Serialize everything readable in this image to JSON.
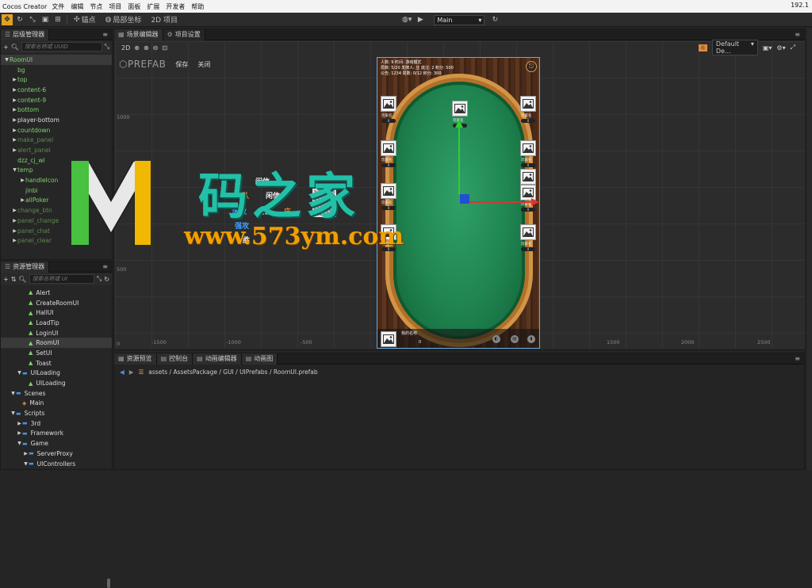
{
  "titlebar": {
    "app": "Cocos Creator",
    "menu": [
      "文件",
      "编辑",
      "节点",
      "项目",
      "面板",
      "扩展",
      "开发者",
      "帮助"
    ],
    "ip": "192.1"
  },
  "toolbar": {
    "pivot": "锚点",
    "local": "局部坐标",
    "mode2d": "2D 项目",
    "platform": "Main"
  },
  "hierarchy": {
    "tab": "层级管理器",
    "search_placeholder": "搜索名称或 UUID",
    "items": [
      {
        "label": "RoomUI",
        "indent": 0,
        "arrow": "▼",
        "color": "green",
        "selected": true
      },
      {
        "label": "bg",
        "indent": 1,
        "arrow": "",
        "color": "green"
      },
      {
        "label": "top",
        "indent": 1,
        "arrow": "▶",
        "color": "green"
      },
      {
        "label": "content-6",
        "indent": 1,
        "arrow": "▶",
        "color": "green"
      },
      {
        "label": "content-9",
        "indent": 1,
        "arrow": "▶",
        "color": "green"
      },
      {
        "label": "bottom",
        "indent": 1,
        "arrow": "▶",
        "color": "green"
      },
      {
        "label": "player-bottom",
        "indent": 1,
        "arrow": "▶",
        "color": "white"
      },
      {
        "label": "countdown",
        "indent": 1,
        "arrow": "▶",
        "color": "green"
      },
      {
        "label": "make_panel",
        "indent": 1,
        "arrow": "▶",
        "color": "dim"
      },
      {
        "label": "alert_panel",
        "indent": 1,
        "arrow": "▶",
        "color": "dim"
      },
      {
        "label": "dzz_cj_wl",
        "indent": 1,
        "arrow": "",
        "color": "green"
      },
      {
        "label": "temp",
        "indent": 1,
        "arrow": "▼",
        "color": "green"
      },
      {
        "label": "handleIcon",
        "indent": 2,
        "arrow": "▶",
        "color": "green"
      },
      {
        "label": "jinbi",
        "indent": 2,
        "arrow": "",
        "color": "green"
      },
      {
        "label": "allPoker",
        "indent": 2,
        "arrow": "▶",
        "color": "green"
      },
      {
        "label": "change_btn",
        "indent": 1,
        "arrow": "▶",
        "color": "dim"
      },
      {
        "label": "panel_change",
        "indent": 1,
        "arrow": "▶",
        "color": "dim"
      },
      {
        "label": "panel_chat",
        "indent": 1,
        "arrow": "▶",
        "color": "dim"
      },
      {
        "label": "panel_clear",
        "indent": 1,
        "arrow": "▶",
        "color": "dim"
      }
    ]
  },
  "assets": {
    "tab": "资源管理器",
    "search_placeholder": "搜索名称或 UI",
    "items": [
      {
        "label": "Alert",
        "indent": 3,
        "arrow": "",
        "icon": "prefab",
        "sel": false
      },
      {
        "label": "CreateRoomUI",
        "indent": 3,
        "arrow": "",
        "icon": "prefab",
        "sel": false
      },
      {
        "label": "HallUI",
        "indent": 3,
        "arrow": "",
        "icon": "prefab",
        "sel": false
      },
      {
        "label": "LoadTip",
        "indent": 3,
        "arrow": "",
        "icon": "prefab",
        "sel": false
      },
      {
        "label": "LoginUI",
        "indent": 3,
        "arrow": "",
        "icon": "prefab",
        "sel": false
      },
      {
        "label": "RoomUI",
        "indent": 3,
        "arrow": "",
        "icon": "prefab",
        "sel": true
      },
      {
        "label": "SetUI",
        "indent": 3,
        "arrow": "",
        "icon": "prefab",
        "sel": false
      },
      {
        "label": "Toast",
        "indent": 3,
        "arrow": "",
        "icon": "prefab",
        "sel": false
      },
      {
        "label": "UILoading",
        "indent": 2,
        "arrow": "▼",
        "icon": "folder",
        "sel": false
      },
      {
        "label": "UILoading",
        "indent": 3,
        "arrow": "",
        "icon": "prefab",
        "sel": false
      },
      {
        "label": "Scenes",
        "indent": 1,
        "arrow": "▼",
        "icon": "folder",
        "sel": false
      },
      {
        "label": "Main",
        "indent": 2,
        "arrow": "",
        "icon": "scene",
        "sel": false
      },
      {
        "label": "Scripts",
        "indent": 1,
        "arrow": "▼",
        "icon": "folder",
        "sel": false
      },
      {
        "label": "3rd",
        "indent": 2,
        "arrow": "▶",
        "icon": "folder",
        "sel": false
      },
      {
        "label": "Framework",
        "indent": 2,
        "arrow": "▶",
        "icon": "folder",
        "sel": false
      },
      {
        "label": "Game",
        "indent": 2,
        "arrow": "▼",
        "icon": "folder",
        "sel": false
      },
      {
        "label": "ServerProxy",
        "indent": 3,
        "arrow": "▶",
        "icon": "folder",
        "sel": false
      },
      {
        "label": "UIControllers",
        "indent": 3,
        "arrow": "▼",
        "icon": "folder",
        "sel": false
      }
    ]
  },
  "scene": {
    "tab_scene": "场景编辑器",
    "tab_settings": "项目设置",
    "mode": "2D",
    "prefab": "PREFAB",
    "save": "保存",
    "close": "关闭",
    "resolution": "Default De...",
    "axis_y": [
      "1000",
      "500",
      "0"
    ],
    "axis_x": [
      "-1500",
      "-1000",
      "-500",
      "1500",
      "2000",
      "2500"
    ],
    "scene_texts": [
      {
        "text": "王",
        "color": "#f0f0f0"
      },
      {
        "text": "闲信",
        "color": "#f0f0f0"
      },
      {
        "text": "闲队",
        "color": "#f08020"
      },
      {
        "text": "闲信",
        "color": "#f0f0f0"
      },
      {
        "text": "闲败",
        "color": "#40a0ff"
      },
      {
        "text": "庄认",
        "color": "#f0f0f0"
      },
      {
        "text": "庄",
        "color": "#f08020"
      },
      {
        "text": "强攻",
        "color": "#40a0ff"
      },
      {
        "text": "胜",
        "color": "#f0f0f0"
      }
    ]
  },
  "game": {
    "info1": "人数: 9  时间: 游戏模式",
    "info2": "局数: 5/20  发牌人: 庄 底注: 2  积分: 500",
    "info3": "公告: 1234  局数: 0/12  积分: 300",
    "seat_label": "玩家名",
    "chip": "0",
    "bottom_name": "我的名称",
    "bottom_val": "0"
  },
  "watermark": {
    "cn": "码之家",
    "url": "www.573ym.com"
  },
  "bottom": {
    "tab_preview": "资源预览",
    "tab_console": "控制台",
    "tab_anim": "动画编辑器",
    "tab_animgraph": "动画图",
    "path": "assets / AssetsPackage / GUI / UIPrefabs / RoomUI.prefab"
  }
}
